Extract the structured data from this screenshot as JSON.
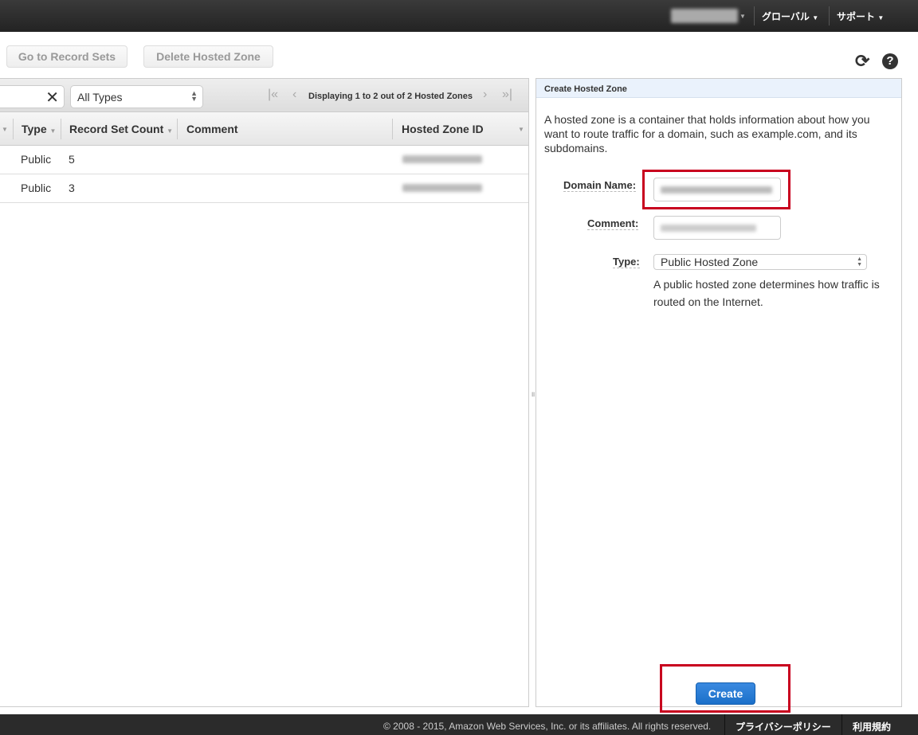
{
  "topbar": {
    "region": "グローバル",
    "support": "サポート"
  },
  "toolbar": {
    "go_to_record_sets": "Go to Record Sets",
    "delete_hosted_zone": "Delete Hosted Zone",
    "icons": [
      "refresh-icon",
      "help-icon"
    ]
  },
  "filter": {
    "type_select": "All Types",
    "pagination": "Displaying 1 to 2 out of 2 Hosted Zones"
  },
  "table": {
    "columns": [
      "Type",
      "Record Set Count",
      "Comment",
      "Hosted Zone ID"
    ],
    "rows": [
      {
        "type": "Public",
        "count": "5",
        "comment": ""
      },
      {
        "type": "Public",
        "count": "3",
        "comment": ""
      }
    ]
  },
  "panel": {
    "title": "Create Hosted Zone",
    "description": "A hosted zone is a container that holds information about how you want to route traffic for a domain, such as example.com, and its subdomains.",
    "domain_label": "Domain Name:",
    "comment_label": "Comment:",
    "type_label": "Type:",
    "type_value": "Public Hosted Zone",
    "type_help": "A public hosted zone determines how traffic is routed on the Internet.",
    "create": "Create"
  },
  "footer": {
    "copyright": "© 2008 - 2015, Amazon Web Services, Inc. or its affiliates. All rights reserved.",
    "privacy": "プライバシーポリシー",
    "terms": "利用規約"
  },
  "colors": {
    "create_button": "#1a6fc9",
    "highlight": "#c8001e"
  }
}
